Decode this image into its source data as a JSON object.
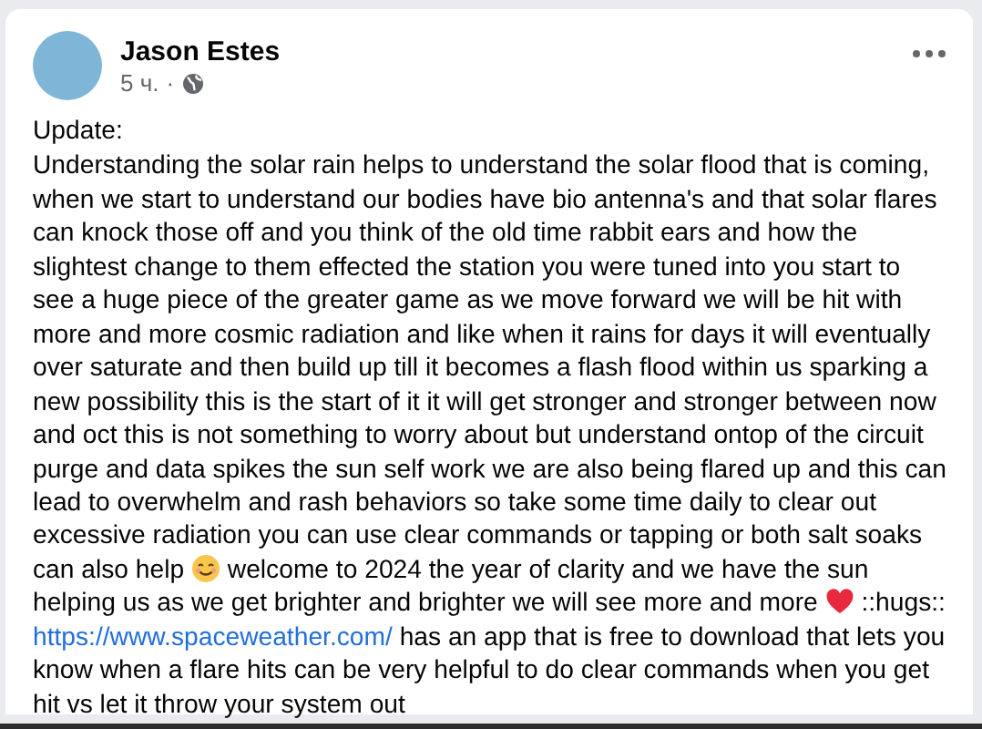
{
  "post": {
    "author": "Jason Estes",
    "time": "5 ч.",
    "separator": "·",
    "title": "Update:",
    "segments": [
      {
        "kind": "text",
        "text": "Understanding the solar rain helps to understand the solar flood that is coming, when we start to understand our bodies have bio antenna's and that solar flares can knock those off and you think of the old time rabbit ears and how the slightest change to them effected the station you were tuned into you start to see a huge piece of the greater game as we move forward we will be hit with more and more cosmic radiation and like when it rains for days it will eventually over saturate and then build up till it becomes a flash flood within us sparking a new possibility this is the start of it it will get stronger and stronger between now and oct this is not something to worry about but understand ontop of the circuit purge and data spikes the sun self work we are also being flared up and this can lead to overwhelm and rash behaviors so take some time daily to clear out excessive radiation you can use clear commands or tapping or both salt soaks can also help"
      },
      {
        "kind": "smile"
      },
      {
        "kind": "text",
        "text": "welcome to 2024 the year of clarity and we have the sun helping us as we get brighter and brighter we will see more and more"
      },
      {
        "kind": "heart"
      },
      {
        "kind": "text",
        "text": "::hugs::"
      }
    ],
    "link": "https://www.spaceweather.com/",
    "link_text": "has an app that is free to download that lets you know when a flare hits can be very helpful to do clear commands when you get hit vs let it throw your system out"
  }
}
